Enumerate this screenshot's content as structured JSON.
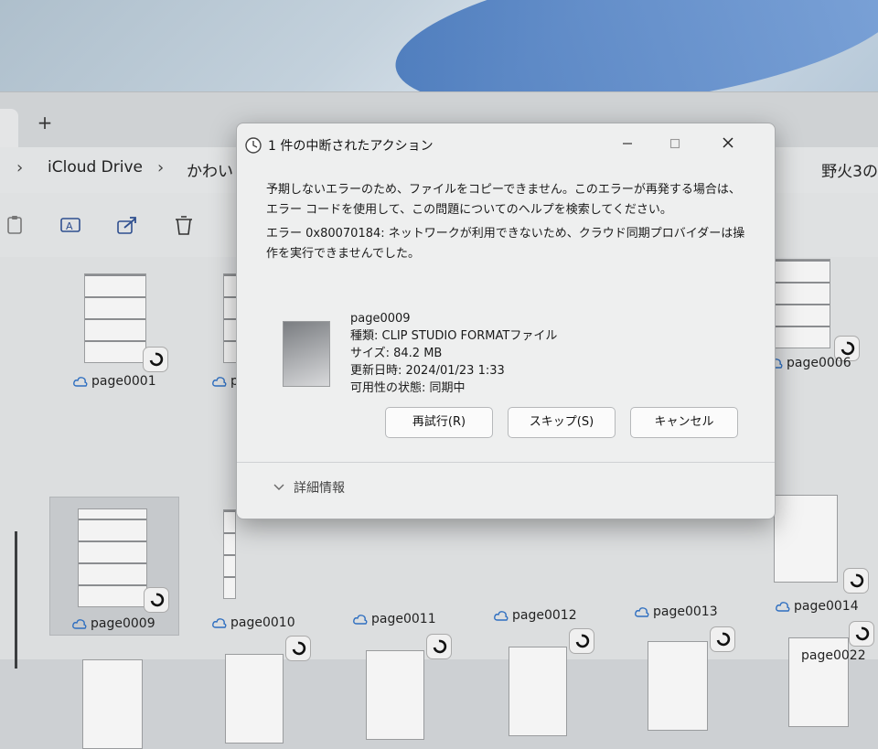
{
  "explorer": {
    "new_tab": "+",
    "breadcrumb": [
      "iCloud Drive",
      "かわい"
    ],
    "right_title": "野火3の"
  },
  "tiles": [
    {
      "label": "page0001"
    },
    {
      "label": "p"
    },
    {
      "label": "page0006"
    },
    {
      "label": "page0009"
    },
    {
      "label": "page0010"
    },
    {
      "label": "page0011"
    },
    {
      "label": "page0012"
    },
    {
      "label": "page0013"
    },
    {
      "label": "page0014"
    },
    {
      "label": "page0022"
    }
  ],
  "dialog": {
    "title": "1 件の中断されたアクション",
    "message": "予期しないエラーのため、ファイルをコピーできません。このエラーが再発する場合は、エラー コードを使用して、この問題についてのヘルプを検索してください。",
    "error": "エラー 0x80070184: ネットワークが利用できないため、クラウド同期プロバイダーは操作を実行できませんでした。",
    "file": {
      "name": "page0009",
      "type": "種類: CLIP STUDIO FORMATファイル",
      "size": "サイズ: 84.2 MB",
      "modified": "更新日時: 2024/01/23 1:33",
      "availability": "可用性の状態: 同期中"
    },
    "buttons": {
      "retry": "再試行(R)",
      "skip": "スキップ(S)",
      "cancel": "キャンセル"
    },
    "details": "詳細情報"
  }
}
